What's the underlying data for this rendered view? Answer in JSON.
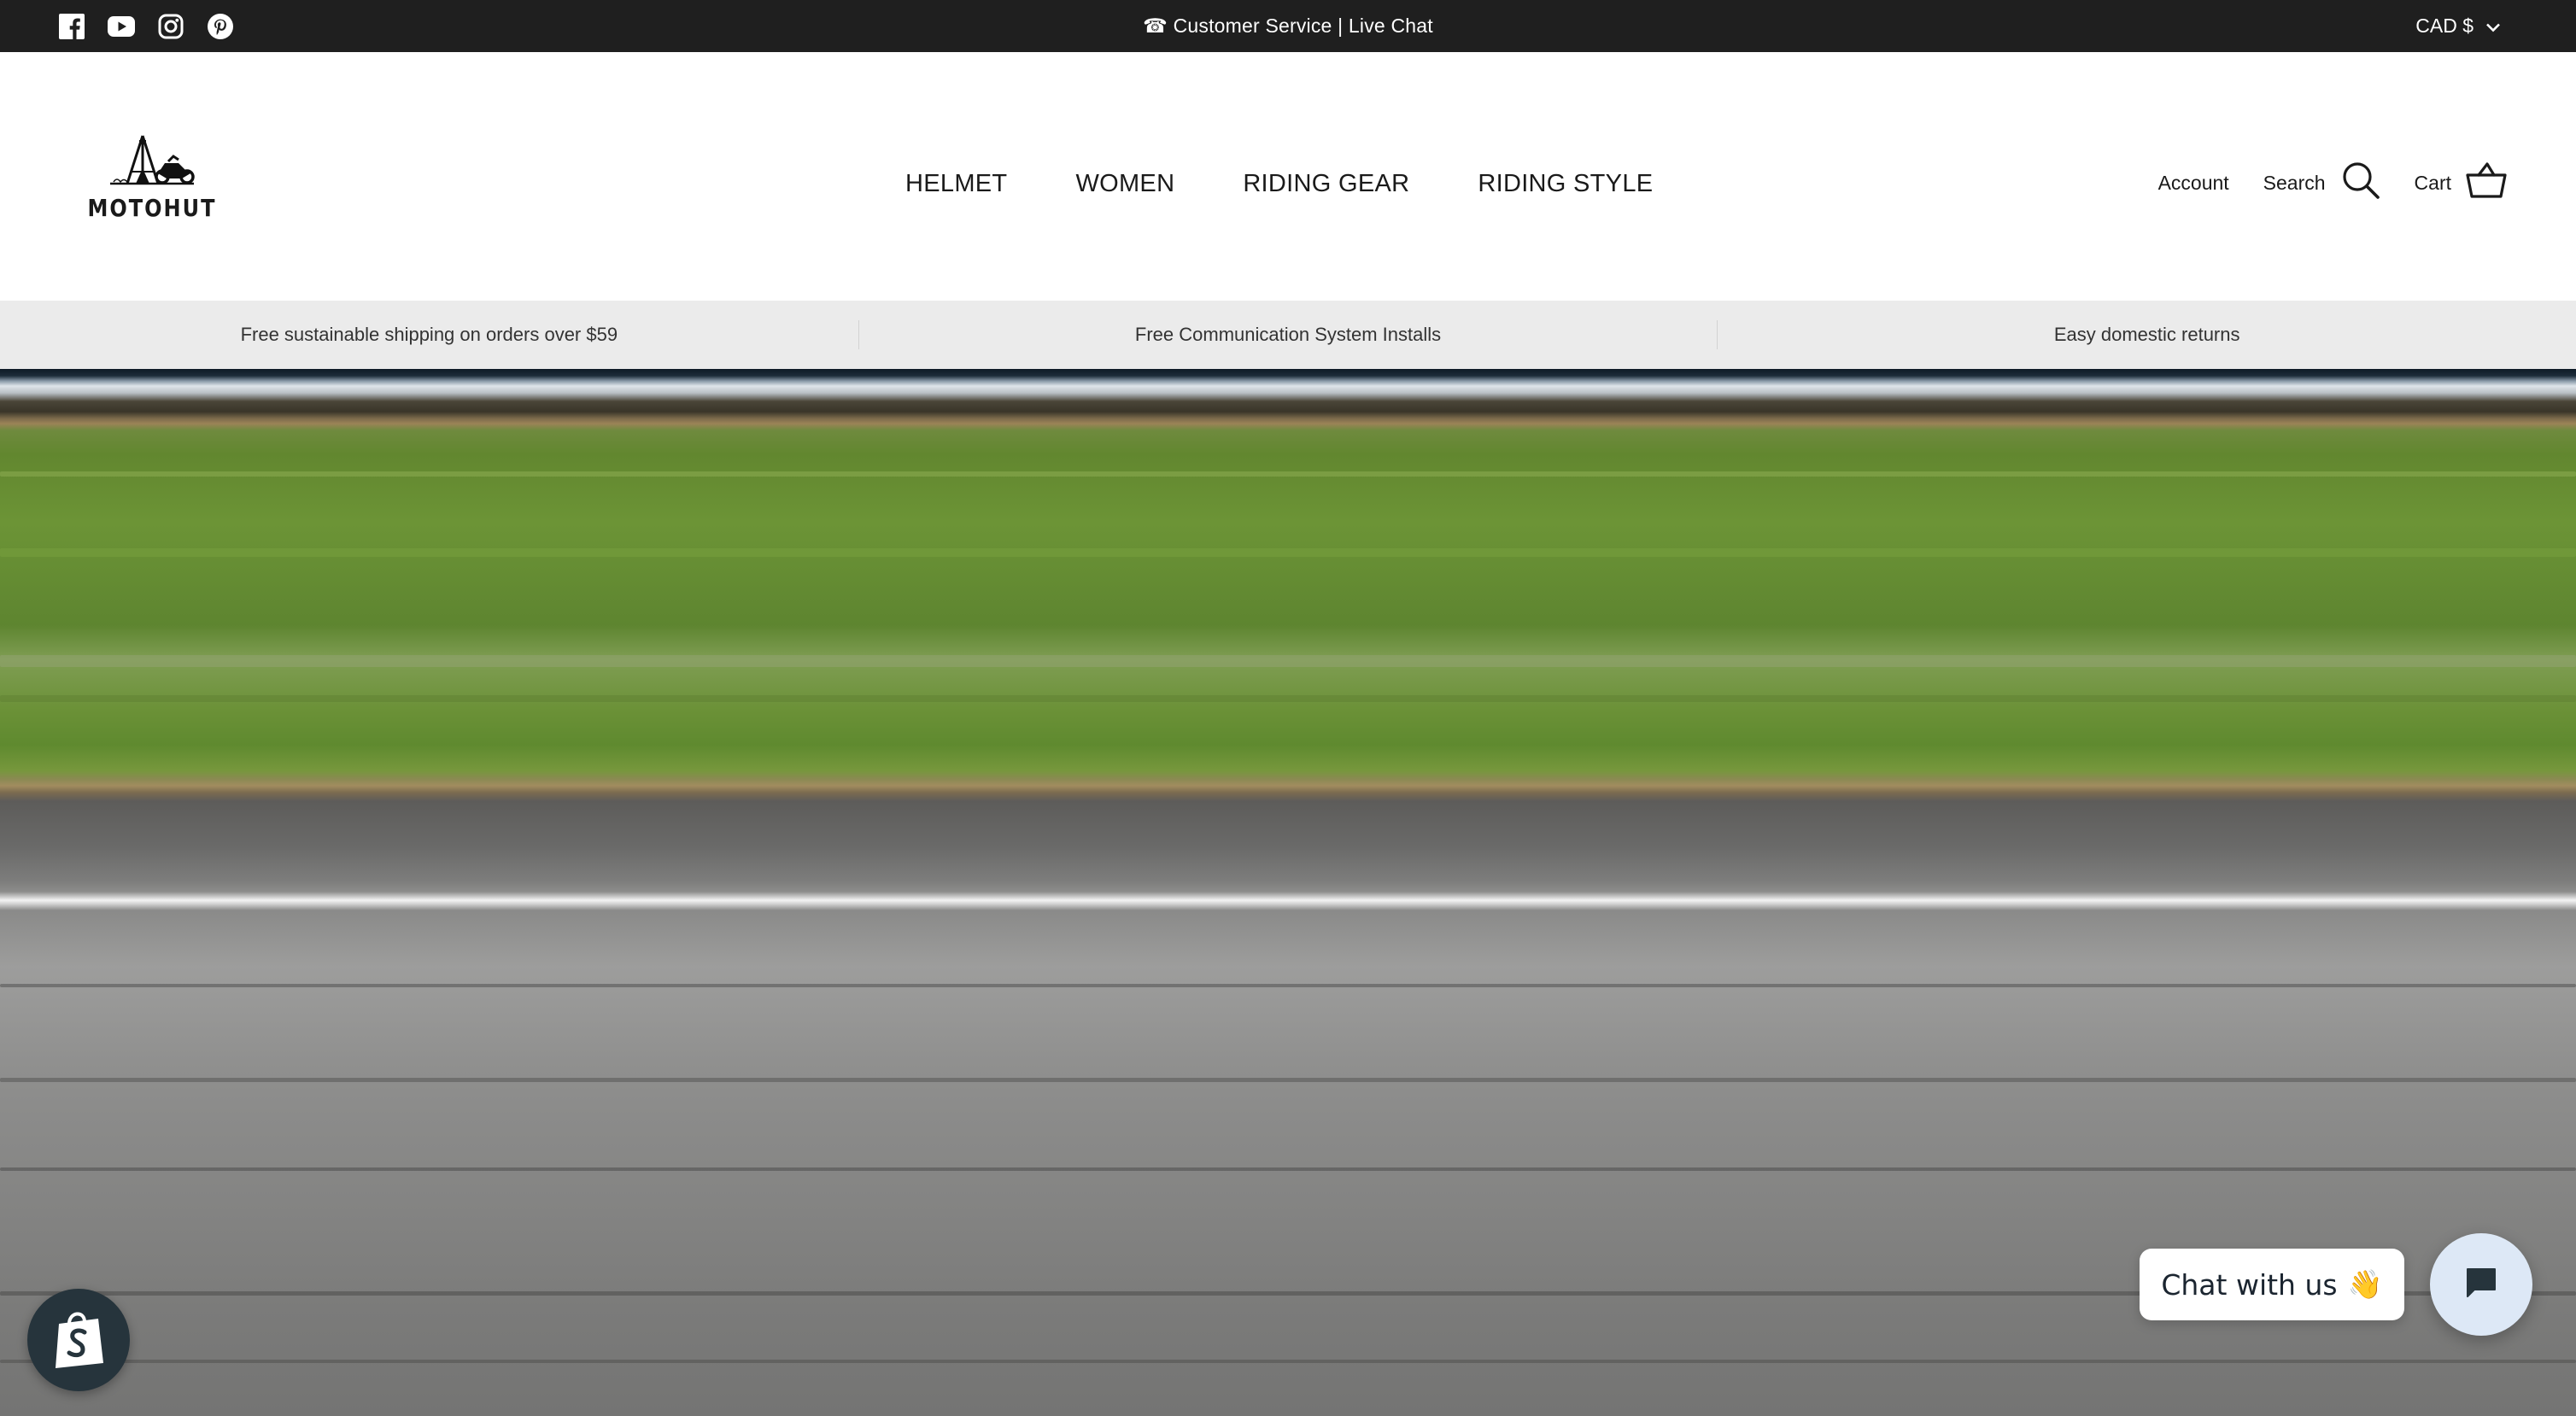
{
  "topbar": {
    "social_icons": [
      "facebook-icon",
      "youtube-icon",
      "instagram-icon",
      "pinterest-icon"
    ],
    "announcement": "☎ Customer Service | Live Chat",
    "currency": "CAD $"
  },
  "header": {
    "logo_text": "MOTOHUT",
    "nav": [
      "HELMET",
      "WOMEN",
      "RIDING GEAR",
      "RIDING STYLE"
    ],
    "account_label": "Account",
    "search_label": "Search",
    "cart_label": "Cart"
  },
  "usp": [
    "Free sustainable shipping on orders over $59",
    "Free Communication System Installs",
    "Easy domestic returns"
  ],
  "chat": {
    "label": "Chat with us",
    "emoji": "👋"
  },
  "colors": {
    "topbar_bg": "#1f1f1f",
    "usp_bg": "#ebebeb",
    "chat_button_bg": "#dde8f6",
    "shop_badge_bg": "#26343c"
  }
}
